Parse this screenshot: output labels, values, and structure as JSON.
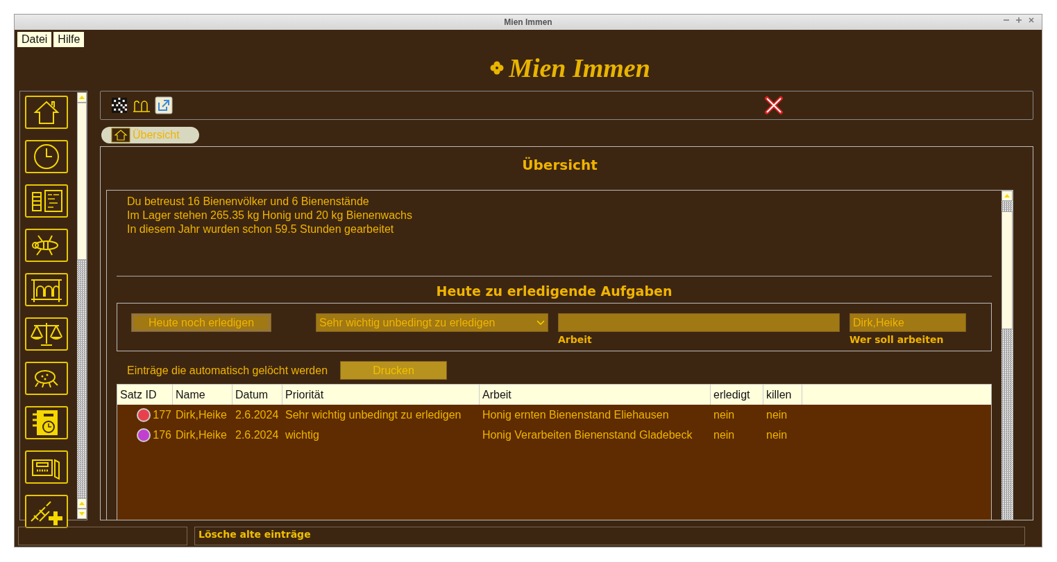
{
  "window": {
    "title": "Mien Immen"
  },
  "menu": [
    "Datei",
    "Hilfe"
  ],
  "logo": "Mien Immen",
  "breadcrumb": {
    "label": "Übersicht",
    "selected": true
  },
  "page": {
    "title": "Übersicht",
    "summary": [
      "Du betreust 16 Bienenvölker und 6 Bienenstände",
      "Im Lager stehen 265.35 kg Honig und 20 kg Bienenwachs",
      "In diesem Jahr wurden schon 59.5 Stunden gearbeitet"
    ],
    "tasks": {
      "title": "Heute zu erledigende Aufgaben",
      "button": "Heute noch erledigen",
      "priority": "Sehr wichtig unbedingt zu erledigen",
      "work_label": "Arbeit",
      "worker": "Dirk,Heike",
      "worker_label": "Wer soll arbeiten"
    },
    "auto_delete_label": "Einträge die automatisch gelöcht werden",
    "print_button": "Drucken",
    "table": {
      "columns": [
        "Satz ID",
        "Name",
        "Datum",
        "Priorität",
        "Arbeit",
        "erledigt",
        "killen"
      ],
      "rows": [
        {
          "color": "#e8404c",
          "cells": [
            "177",
            "Dirk,Heike",
            "2.6.2024",
            "Sehr wichtig unbedingt zu erledigen",
            "Honig ernten Bienenstand Eliehausen",
            "nein",
            "nein"
          ]
        },
        {
          "color": "#c040d0",
          "cells": [
            "176",
            "Dirk,Heike",
            "2.6.2024",
            "wichtig",
            "Honig Verarbeiten Bienenstand Gladebeck",
            "nein",
            "nein"
          ]
        }
      ]
    }
  },
  "status_bar": {
    "message": "Lösche alte einträge"
  }
}
